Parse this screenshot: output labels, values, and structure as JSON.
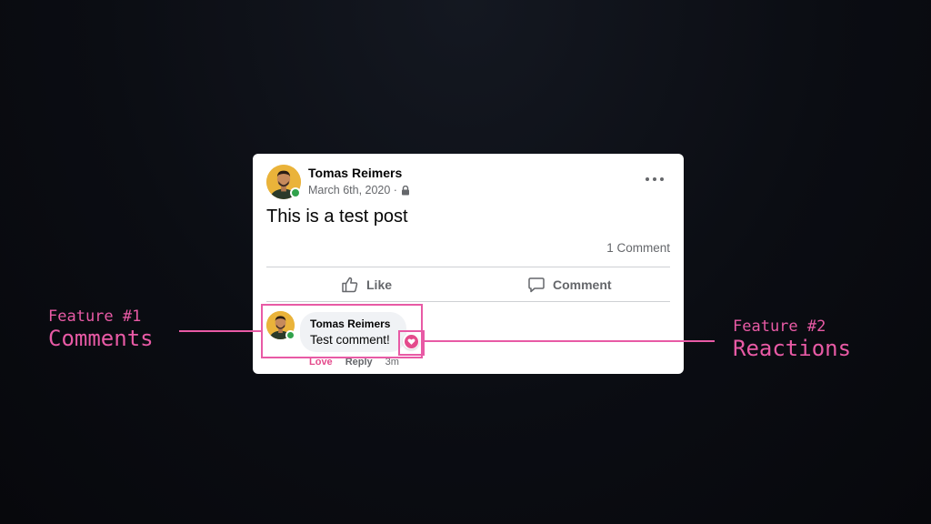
{
  "post": {
    "author": "Tomas Reimers",
    "date": "March 6th, 2020 ·",
    "privacy_icon": "lock-icon",
    "body": "This is a test post",
    "comment_count": "1 Comment",
    "more_icon": "more-options-icon"
  },
  "actions": {
    "like_label": "Like",
    "comment_label": "Comment"
  },
  "comment": {
    "author": "Tomas Reimers",
    "text": "Test comment!",
    "reaction_icon": "heart-icon",
    "love_label": "Love",
    "reply_label": "Reply",
    "time": "3m"
  },
  "annotations": {
    "feature1_number": "Feature #1",
    "feature1_name": "Comments",
    "feature2_number": "Feature #2",
    "feature2_name": "Reactions"
  },
  "colors": {
    "accent": "#e85aa5",
    "love": "#e44b8c",
    "online": "#31a24c",
    "secondary_text": "#65676b"
  }
}
